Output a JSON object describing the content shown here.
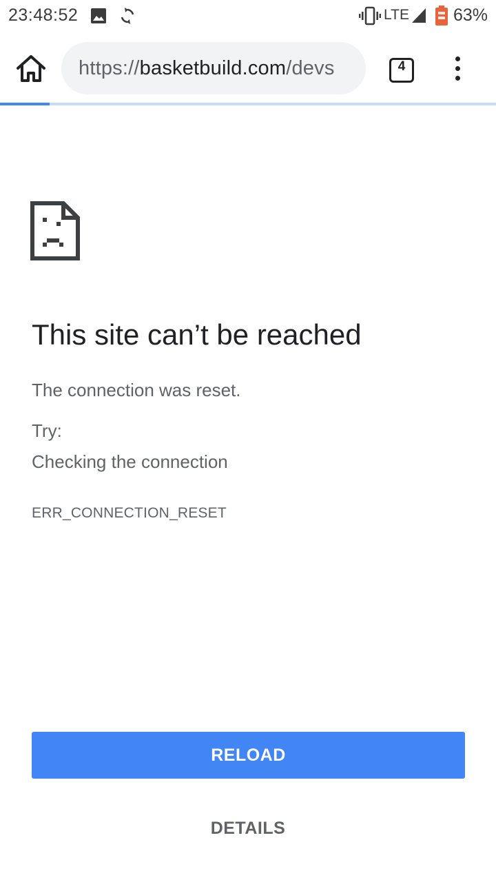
{
  "status_bar": {
    "time": "23:48:52",
    "network": "LTE",
    "battery": "63%",
    "icons": [
      "image-icon",
      "sync-icon",
      "vibrate-icon",
      "signal-icon",
      "battery-icon"
    ]
  },
  "toolbar": {
    "url_scheme": "https://",
    "url_host": "basketbuild.com",
    "url_path": "/devs",
    "tab_count": "4",
    "icons": [
      "home-icon",
      "tabs-icon",
      "more-vert-icon"
    ]
  },
  "page_load_progress": 0.1,
  "error": {
    "title": "This site can’t be reached",
    "description": "The connection was reset.",
    "try_label": "Try:",
    "suggestion": "Checking the connection",
    "code": "ERR_CONNECTION_RESET"
  },
  "actions": {
    "reload_label": "RELOAD",
    "details_label": "DETAILS"
  },
  "colors": {
    "accent": "#4285f4",
    "text_primary": "#202124",
    "text_secondary": "#5f6368",
    "omnibox_bg": "#f1f3f4",
    "battery": "#e8643c"
  }
}
